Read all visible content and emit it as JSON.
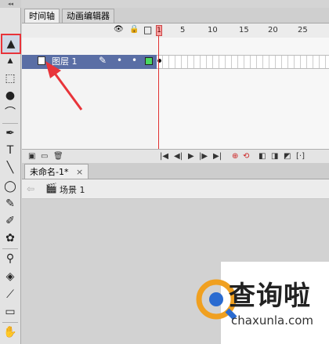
{
  "toolbar": {
    "collapse_label": "◂◂",
    "tools": [
      {
        "name": "selection-tool",
        "glyph": "▲"
      },
      {
        "name": "subselection-tool",
        "glyph": "▴"
      },
      {
        "name": "free-transform-tool",
        "glyph": "⬚"
      },
      {
        "name": "3d-rotation-tool",
        "glyph": "●"
      },
      {
        "name": "lasso-tool",
        "glyph": "⌒"
      },
      {
        "name": "pen-tool",
        "glyph": "✒"
      },
      {
        "name": "text-tool",
        "glyph": "T"
      },
      {
        "name": "line-tool",
        "glyph": "╲"
      },
      {
        "name": "oval-tool",
        "glyph": "◯"
      },
      {
        "name": "pencil-tool",
        "glyph": "✎"
      },
      {
        "name": "brush-tool",
        "glyph": "✐"
      },
      {
        "name": "deco-tool",
        "glyph": "✿"
      },
      {
        "name": "bone-tool",
        "glyph": "⚲"
      },
      {
        "name": "paint-bucket-tool",
        "glyph": "◈"
      },
      {
        "name": "eyedropper-tool",
        "glyph": "⟋"
      },
      {
        "name": "eraser-tool",
        "glyph": "▭"
      },
      {
        "name": "hand-tool",
        "glyph": "✋"
      }
    ]
  },
  "panel_tabs": {
    "timeline": "时间轴",
    "motion_editor": "动画编辑器"
  },
  "timeline": {
    "header_icons": {
      "eye": "👁",
      "lock": "🔒",
      "outline": "□"
    },
    "frame_numbers": [
      "1",
      "5",
      "10",
      "15",
      "20",
      "25"
    ],
    "playhead_frame": "1",
    "layer": {
      "name": "图层 1",
      "pencil": "✎",
      "dot1": "•",
      "dot2": "•"
    },
    "bottom_icons": {
      "new_layer": "▣",
      "new_folder": "▭",
      "delete": "🗑"
    },
    "playback": {
      "first": "|◀",
      "prev": "◀|",
      "play": "▶",
      "next": "|▶",
      "last": "▶|",
      "center": "⊕",
      "loop": "⟲",
      "onion": "◧",
      "onion_outline": "◨",
      "edit_multiple": "◩",
      "markers": "[·]"
    }
  },
  "document": {
    "tab_label": "未命名-1*",
    "close_label": "×"
  },
  "scene": {
    "back_arrow": "⇦",
    "scene_icon": "🎬",
    "name": "场景 1"
  },
  "watermark": {
    "brand": "查询啦",
    "url": "chaxunla.com"
  },
  "colors": {
    "selection_highlight": "#e8343a",
    "layer_row": "#5a6ea5",
    "playhead": "#e03030",
    "watermark_orange": "#f0a020",
    "watermark_blue": "#2a6bd0"
  }
}
